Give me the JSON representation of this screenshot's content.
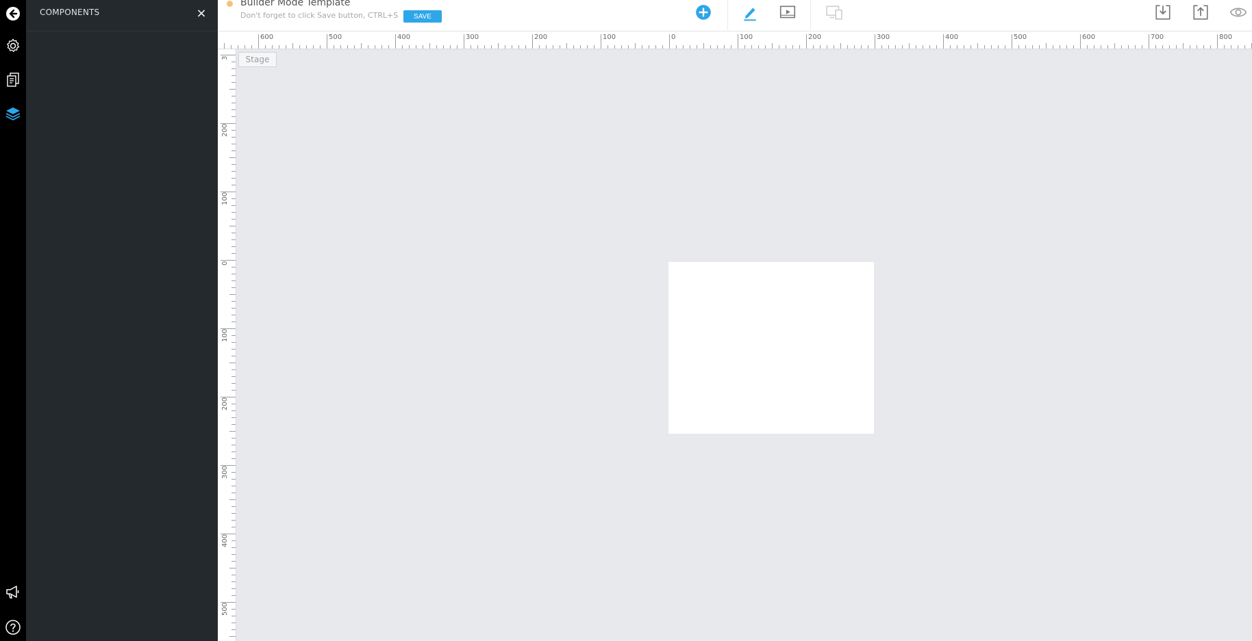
{
  "rail": {
    "items": [
      {
        "name": "back-icon",
        "label": "Back"
      },
      {
        "name": "gear-icon",
        "label": "Settings"
      },
      {
        "name": "pages-icon",
        "label": "Pages"
      },
      {
        "name": "layers-icon",
        "label": "Layers",
        "active": true
      },
      {
        "name": "megaphone-icon",
        "label": "Announcements"
      },
      {
        "name": "help-icon",
        "label": "Help"
      }
    ]
  },
  "panel": {
    "title": "COMPONENTS",
    "close_glyph": "×"
  },
  "header": {
    "title": "Builder Mode Template",
    "hint": "Don't forget to click Save button, CTRL+S",
    "save_label": "SAVE"
  },
  "toolbar": {
    "icons": [
      "add-icon",
      "pencil-icon",
      "preview-play-icon",
      "responsive-devices-icon",
      "import-icon",
      "export-icon",
      "eye-icon"
    ]
  },
  "ruler": {
    "top_labels": [
      "600",
      "500",
      "400",
      "300",
      "200",
      "100",
      "0",
      "100",
      "200",
      "300",
      "400",
      "500",
      "600",
      "700",
      "800"
    ],
    "left_labels": [
      "3",
      "200",
      "100",
      "0",
      "100",
      "200",
      "300",
      "400",
      "500"
    ]
  },
  "stage": {
    "label": "Stage"
  },
  "colors": {
    "accent": "#2ea6e8",
    "rail_bg": "#000000",
    "panel_bg": "#24292d",
    "workspace_bg": "#e7e9ec",
    "status_dot": "#f5c27b"
  }
}
